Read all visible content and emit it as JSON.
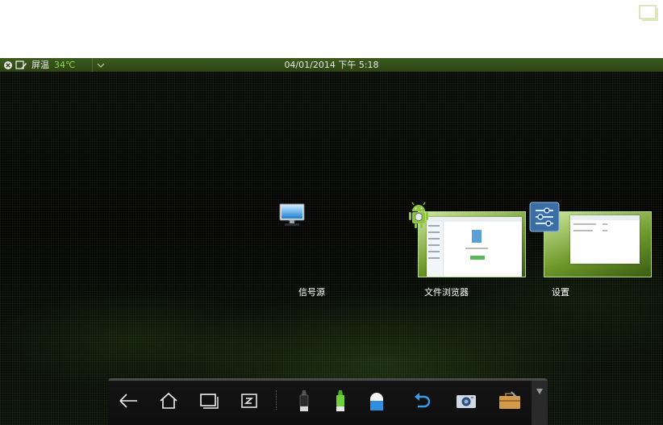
{
  "status_bar": {
    "temp_label": "屏温",
    "temp_value": "34℃",
    "datetime": "04/01/2014 下午 5:18"
  },
  "recent_apps": [
    {
      "name": "信号源",
      "icon": "monitor-icon"
    },
    {
      "name": "文件浏览器",
      "icon": "android-icon"
    },
    {
      "name": "设置",
      "icon": "settings-sliders-icon"
    }
  ],
  "navbar": {
    "buttons": [
      "back-icon",
      "home-icon",
      "recent-apps-icon",
      "zoom-icon",
      "black-marker-icon",
      "green-marker-icon",
      "eraser-icon",
      "undo-icon",
      "camera-icon",
      "toolbox-icon"
    ],
    "more": "chevron-down-icon"
  },
  "colors": {
    "status_bar": "#3c5a1d",
    "temp_value": "#8fd14f",
    "thumb_border": "#b7d98f"
  }
}
